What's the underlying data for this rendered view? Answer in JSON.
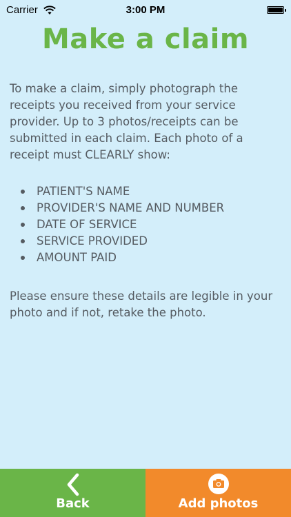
{
  "status_bar": {
    "carrier": "Carrier",
    "time": "3:00 PM"
  },
  "page": {
    "title": "Make a claim",
    "intro": "To make a claim, simply photograph the receipts you received from your service provider. Up to 3 photos/receipts can be submitted in each claim. Each photo of a receipt must CLEARLY show:",
    "requirements": [
      "PATIENT'S NAME",
      "PROVIDER'S NAME AND NUMBER",
      "DATE OF SERVICE",
      "SERVICE PROVIDED",
      "AMOUNT PAID"
    ],
    "outro": "Please ensure these details are legible in your photo and if not, retake the photo."
  },
  "bottom_bar": {
    "back_label": "Back",
    "add_photos_label": "Add photos"
  },
  "colors": {
    "background": "#d3eefa",
    "title": "#6ab548",
    "back_button": "#6ab548",
    "add_photos_button": "#f28a2b",
    "body_text": "#555b61"
  },
  "icons": {
    "back": "chevron-left-icon",
    "add_photos": "camera-icon",
    "wifi": "wifi-icon",
    "battery": "battery-icon"
  }
}
